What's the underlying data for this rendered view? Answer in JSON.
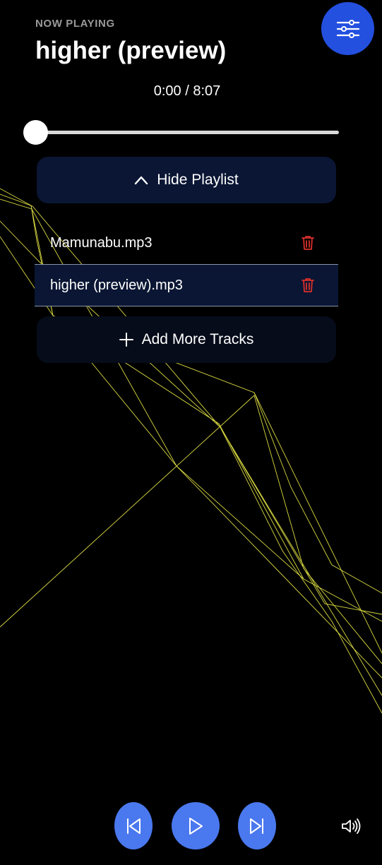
{
  "header": {
    "now_playing_label": "NOW PLAYING",
    "track_title": "higher (preview)"
  },
  "playback": {
    "current_time": "0:00",
    "separator": " / ",
    "duration": "8:07",
    "progress_fraction": 0.0
  },
  "playlist_toggle": {
    "label": "Hide Playlist",
    "icon": "chevron-up-icon"
  },
  "playlist": {
    "tracks": [
      {
        "name": "Mamunabu.mp3",
        "active": false
      },
      {
        "name": "higher (preview).mp3",
        "active": true
      }
    ]
  },
  "add_tracks": {
    "label": "Add More Tracks",
    "icon": "plus-icon"
  },
  "controls": {
    "settings_icon": "sliders-icon",
    "previous_icon": "skip-back-icon",
    "play_icon": "play-icon",
    "next_icon": "skip-forward-icon",
    "volume_icon": "volume-icon"
  },
  "colors": {
    "background": "#000000",
    "accent": "#2450e0",
    "control_button": "#4a78ee",
    "panel": "#0a1633",
    "delete": "#d9302b",
    "visualizer_line": "#f2f24a"
  }
}
